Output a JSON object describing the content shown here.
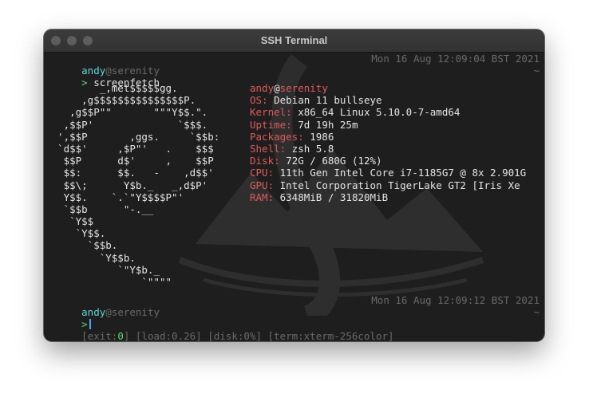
{
  "window": {
    "title": "SSH Terminal"
  },
  "session1": {
    "user": "andy",
    "host": "@serenity",
    "timestamp": "Mon 16 Aug 12:09:04 BST 2021",
    "tilde": "~",
    "prompt": ">",
    "command": "screenfetch"
  },
  "logo": {
    "lines": [
      "         _,met$$$$$gg.",
      "      ,g$$$$$$$$$$$$$$$P.",
      "    ,g$$P\"\"       \"\"\"Y$$.\".",
      "   ,$$P'              `$$$.",
      "  ',$$P       ,ggs.     `$$b:",
      "  `d$$'     ,$P\"'   .    $$$",
      "   $$P      d$'     ,    $$P",
      "   $$:      $$.   -    ,d$$'",
      "   $$\\;      Y$b._   _,d$P'",
      "   Y$$.    `.`\"Y$$$$P\"'",
      "   `$$b      \"-.__",
      "    `Y$$",
      "     `Y$$.",
      "       `$$b.",
      "         `Y$$b.",
      "            `\"Y$b._",
      "                `\"\"\"\""
    ]
  },
  "info": {
    "user": "andy",
    "at": "@",
    "host": "serenity",
    "rows": [
      {
        "key": "OS:",
        "value": " Debian 11 bullseye"
      },
      {
        "key": "Kernel:",
        "value": " x86_64 Linux 5.10.0-7-amd64"
      },
      {
        "key": "Uptime:",
        "value": " 7d 19h 25m"
      },
      {
        "key": "Packages:",
        "value": " 1986"
      },
      {
        "key": "Shell:",
        "value": " zsh 5.8"
      },
      {
        "key": "Disk:",
        "value": " 72G / 680G (12%)"
      },
      {
        "key": "CPU:",
        "value": " 11th Gen Intel Core i7-1185G7 @ 8x 2.901G"
      },
      {
        "key": "GPU:",
        "value": " Intel Corporation TigerLake GT2 [Iris Xe"
      },
      {
        "key": "RAM:",
        "value": " 6348MiB / 31820MiB"
      }
    ]
  },
  "session2": {
    "user": "andy",
    "host": "@serenity",
    "timestamp": "Mon 16 Aug 12:09:12 BST 2021",
    "tilde": "~",
    "prompt": ">"
  },
  "statusbar": {
    "exit_label": "[exit:",
    "exit_value": "0",
    "exit_close": "]",
    "load": "[load:0.26]",
    "disk": "[disk:0%]",
    "term": "[term:xterm-256color]"
  },
  "colors": {
    "user": "#5fd7d7",
    "host": "#6a6a6a",
    "prompt": "#5fd75f",
    "info_key": "#e05a5a",
    "cursor": "#4aa3ff"
  }
}
